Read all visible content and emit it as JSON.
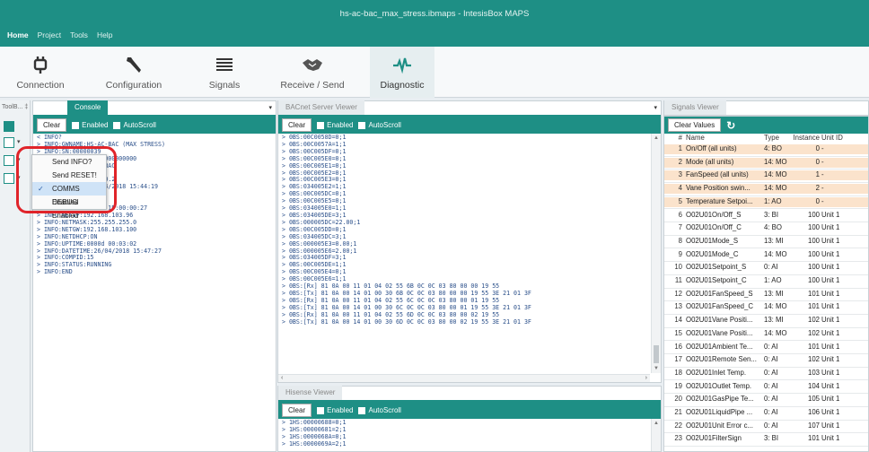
{
  "window": {
    "title": "hs-ac-bac_max_stress.ibmaps - IntesisBox MAPS"
  },
  "menu": [
    "Home",
    "Project",
    "Tools",
    "Help"
  ],
  "ribbon": [
    {
      "label": "Connection",
      "icon": "plug-icon"
    },
    {
      "label": "Configuration",
      "icon": "wrench-icon"
    },
    {
      "label": "Signals",
      "icon": "list-icon"
    },
    {
      "label": "Receive / Send",
      "icon": "handshake-icon"
    },
    {
      "label": "Diagnostic",
      "icon": "pulse-icon"
    }
  ],
  "toolbox": {
    "title": "ToolB...",
    "pin": "‡"
  },
  "console": {
    "tab": "Console",
    "clear": "Clear",
    "enabled": "Enabled",
    "autoscroll": "AutoScroll",
    "lines": [
      "< INFO?",
      "> INFO:GWNAME:HS-AC-BAC (MAX STRESS)",
      "> INFO:SN:00000039",
      "> INFO:MAC:00:00000000000000",
      "> INFO:BNAME:HS-AC-BAC",
      "> INFO:PORT:4",
      "> INFO:VERSION:0.0.0.2",
      "> INFO:CFGDATE:26/04/2018 15:44:19",
      "> INFO:CFGCHG:N",
      "> INFO:MID:1",
      "> INFO:ETHMAC:CC:3F:1D:00:00:27",
      "> INFO:NETIP:192.168.103.96",
      "> INFO:NETMASK:255.255.255.0",
      "> INFO:NETGW:192.168.103.100",
      "> INFO:NETDHCP:ON",
      "> INFO:UPTIME:0000d 00:03:02",
      "> INFO:DATETIME:26/04/2018 15:47:27",
      "> INFO:COMPID:15",
      "> INFO:STATUS:RUNNING",
      "> INFO:END"
    ]
  },
  "context_menu": {
    "items": [
      {
        "label": "Send INFO?",
        "checked": false
      },
      {
        "label": "Send RESET!",
        "checked": false
      },
      {
        "label": "COMMS Enabled",
        "checked": true
      },
      {
        "label": "DEBUG Enabled",
        "checked": false
      }
    ],
    "check_glyph": "✓"
  },
  "bacnet": {
    "tab": "BACnet Server Viewer",
    "clear": "Clear",
    "enabled": "Enabled",
    "autoscroll": "AutoScroll",
    "lines": [
      "> 0BS:00C0058D=0;1",
      "> 0BS:00C0057A=1;1",
      "> 0BS:00C005DF=0;1",
      "> 0BS:00C005E0=0;1",
      "> 0BS:00C005E1=0;1",
      "> 0BS:00C005E2=0;1",
      "> 0BS:00C005E3=0;1",
      "> 0BS:034005E2=1;1",
      "> 0BS:00C005DC=0;1",
      "> 0BS:00C005E5=0;1",
      "> 0BS:034005E0=1;1",
      "> 0BS:034005DE=3;1",
      "> 0BS:000005DC=22.00;1",
      "> 0BS:00C005DD=0;1",
      "> 0BS:034005DC=3;1",
      "> 0BS:000005E3=0.00;1",
      "> 0BS:000005E6=2.00;1",
      "> 0BS:034005DF=3;1",
      "> 0BS:00C005DE=1;1",
      "> 0BS:00C005E4=0;1",
      "> 0BS:00C005E6=1;1",
      "> 0BS:[Rx] 81 0A 00 11 01 04 02 55 6B 0C 0C 03 80 00 00 19 55",
      "> 0BS:[Tx] 81 0A 00 14 01 00 30 6B 0C 0C 03 80 00 00 19 55 3E 21 01 3F",
      "> 0BS:[Rx] 81 0A 00 11 01 04 02 55 6C 0C 0C 03 80 00 01 19 55",
      "> 0BS:[Tx] 81 0A 00 14 01 00 30 6C 0C 0C 03 80 00 01 19 55 3E 21 01 3F",
      "> 0BS:[Rx] 81 0A 00 11 01 04 02 55 6D 0C 0C 03 80 00 02 19 55",
      "> 0BS:[Tx] 81 0A 00 14 01 00 30 6D 0C 0C 03 80 00 02 19 55 3E 21 01 3F"
    ]
  },
  "hisense": {
    "tab": "Hisense Viewer",
    "clear": "Clear",
    "enabled": "Enabled",
    "autoscroll": "AutoScroll",
    "lines": [
      "> 1HS:00000688=0;1",
      "> 1HS:00000681=2;1",
      "> 1HS:0000068A=0;1",
      "> 1HS:0000069A=2;1"
    ]
  },
  "signals": {
    "tab": "Signals Viewer",
    "clear_values": "Clear Values",
    "columns": [
      "#",
      "Name",
      "Type",
      "Instance",
      "Unit ID"
    ],
    "rows": [
      {
        "num": "1",
        "name": "On/Off (all units)",
        "type": "4: BO",
        "instance": "0",
        "unit": "-",
        "hl": true
      },
      {
        "num": "2",
        "name": "Mode (all units)",
        "type": "14: MO",
        "instance": "0",
        "unit": "-",
        "hl": true
      },
      {
        "num": "3",
        "name": "FanSpeed (all units)",
        "type": "14: MO",
        "instance": "1",
        "unit": "-",
        "hl": true
      },
      {
        "num": "4",
        "name": "Vane Position swin...",
        "type": "14: MO",
        "instance": "2",
        "unit": "-",
        "hl": true
      },
      {
        "num": "5",
        "name": "Temperature Setpoi...",
        "type": "1: AO",
        "instance": "0",
        "unit": "-",
        "hl": true
      },
      {
        "num": "6",
        "name": "O02U01On/Off_S",
        "type": "3: BI",
        "instance": "100",
        "unit": "Unit 1",
        "hl": false
      },
      {
        "num": "7",
        "name": "O02U01On/Off_C",
        "type": "4: BO",
        "instance": "100",
        "unit": "Unit 1",
        "hl": false
      },
      {
        "num": "8",
        "name": "O02U01Mode_S",
        "type": "13: MI",
        "instance": "100",
        "unit": "Unit 1",
        "hl": false
      },
      {
        "num": "9",
        "name": "O02U01Mode_C",
        "type": "14: MO",
        "instance": "100",
        "unit": "Unit 1",
        "hl": false
      },
      {
        "num": "10",
        "name": "O02U01Setpoint_S",
        "type": "0: AI",
        "instance": "100",
        "unit": "Unit 1",
        "hl": false
      },
      {
        "num": "11",
        "name": "O02U01Setpoint_C",
        "type": "1: AO",
        "instance": "100",
        "unit": "Unit 1",
        "hl": false
      },
      {
        "num": "12",
        "name": "O02U01FanSpeed_S",
        "type": "13: MI",
        "instance": "101",
        "unit": "Unit 1",
        "hl": false
      },
      {
        "num": "13",
        "name": "O02U01FanSpeed_C",
        "type": "14: MO",
        "instance": "101",
        "unit": "Unit 1",
        "hl": false
      },
      {
        "num": "14",
        "name": "O02U01Vane Positi...",
        "type": "13: MI",
        "instance": "102",
        "unit": "Unit 1",
        "hl": false
      },
      {
        "num": "15",
        "name": "O02U01Vane Positi...",
        "type": "14: MO",
        "instance": "102",
        "unit": "Unit 1",
        "hl": false
      },
      {
        "num": "16",
        "name": "O02U01Ambient Te...",
        "type": "0: AI",
        "instance": "101",
        "unit": "Unit 1",
        "hl": false
      },
      {
        "num": "17",
        "name": "O02U01Remote Sen...",
        "type": "0: AI",
        "instance": "102",
        "unit": "Unit 1",
        "hl": false
      },
      {
        "num": "18",
        "name": "O02U01Inlet Temp.",
        "type": "0: AI",
        "instance": "103",
        "unit": "Unit 1",
        "hl": false
      },
      {
        "num": "19",
        "name": "O02U01Outlet Temp.",
        "type": "0: AI",
        "instance": "104",
        "unit": "Unit 1",
        "hl": false
      },
      {
        "num": "20",
        "name": "O02U01GasPipe Te...",
        "type": "0: AI",
        "instance": "105",
        "unit": "Unit 1",
        "hl": false
      },
      {
        "num": "21",
        "name": "O02U01LiquidPipe ...",
        "type": "0: AI",
        "instance": "106",
        "unit": "Unit 1",
        "hl": false
      },
      {
        "num": "22",
        "name": "O02U01Unit Error c...",
        "type": "0: AI",
        "instance": "107",
        "unit": "Unit 1",
        "hl": false
      },
      {
        "num": "23",
        "name": "O02U01FilterSign",
        "type": "3: BI",
        "instance": "101",
        "unit": "Unit 1",
        "hl": false
      }
    ]
  },
  "colors": {
    "accent": "#1e8f85",
    "highlight_row": "#fbe3cc",
    "annotation": "#e0242a",
    "log_text": "#2a4f8a"
  }
}
